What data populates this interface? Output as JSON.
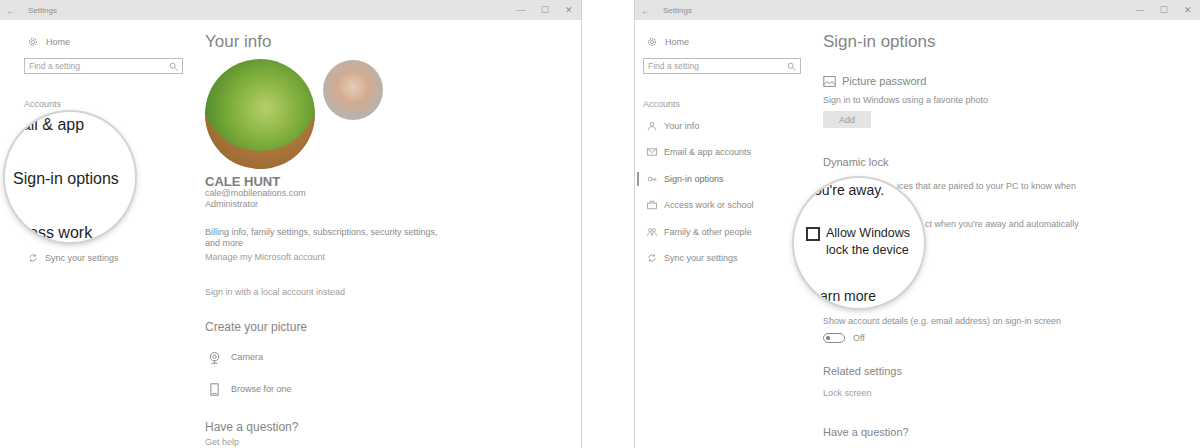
{
  "left_window": {
    "title": "Settings",
    "back": "←",
    "controls": [
      "—",
      "☐",
      "✕"
    ],
    "sidebar": {
      "home": "Home",
      "search": {
        "placeholder": "Find a setting"
      },
      "section": "Accounts",
      "items": [
        {
          "label": "Sync your settings",
          "selected": false
        }
      ]
    },
    "magnifier": {
      "lines": [
        "nail & app",
        "Sign-in options",
        "ccess work"
      ]
    },
    "main": {
      "heading": "Your info",
      "name": "CALE HUNT",
      "email": "cale@mobilenations.com",
      "role": "Administrator",
      "description": "Billing info, family settings, subscriptions, security settings, and more",
      "links": [
        "Manage my Microsoft account",
        "Sign in with a local account instead"
      ],
      "picture": {
        "heading": "Create your picture",
        "options": [
          "Camera",
          "Browse for one"
        ]
      },
      "help": {
        "heading": "Have a question?",
        "link": "Get help"
      }
    }
  },
  "right_window": {
    "title": "Settings",
    "back": "←",
    "controls": [
      "—",
      "☐",
      "✕"
    ],
    "sidebar": {
      "home": "Home",
      "search": {
        "placeholder": "Find a setting"
      },
      "section": "Accounts",
      "items": [
        {
          "label": "Your info",
          "selected": false
        },
        {
          "label": "Email & app accounts",
          "selected": false
        },
        {
          "label": "Sign-in options",
          "selected": true
        },
        {
          "label": "Access work or school",
          "selected": false
        },
        {
          "label": "Family & other people",
          "selected": false
        },
        {
          "label": "Sync your settings",
          "selected": false
        }
      ]
    },
    "main": {
      "heading": "Sign-in options",
      "picture_password": {
        "title": "Picture password",
        "description": "Sign in to Windows using a favorite photo",
        "button": "Add"
      },
      "dynamic_lock": {
        "title": "Dynamic lock",
        "description_fragments": [
          "ices that are paired to your PC to know when",
          "ct when you're away and automatically"
        ]
      },
      "account_details": {
        "label": "Show account details (e.g. email address) on sign-in screen",
        "on": false,
        "state_text": "Off"
      },
      "related": {
        "heading": "Related settings",
        "link": "Lock screen"
      },
      "help": {
        "heading": "Have a question?"
      }
    },
    "magnifier": {
      "text": "ou're away.",
      "checkbox": {
        "label_lines": [
          "Allow Windows",
          "lock the device"
        ],
        "checked": false
      },
      "footer": "arn more"
    }
  }
}
